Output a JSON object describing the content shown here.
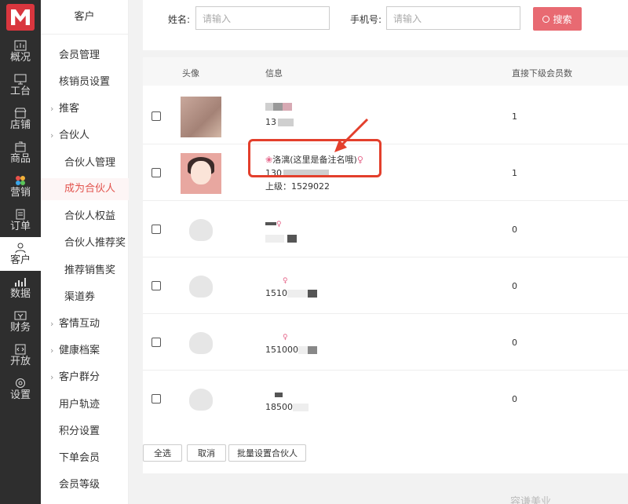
{
  "rail": {
    "items": [
      {
        "label": "概况",
        "icon": "chart-icon"
      },
      {
        "label": "工台",
        "icon": "monitor-icon"
      },
      {
        "label": "店铺",
        "icon": "store-icon"
      },
      {
        "label": "商品",
        "icon": "box-icon"
      },
      {
        "label": "营销",
        "icon": "marketing-icon"
      },
      {
        "label": "订单",
        "icon": "order-icon"
      },
      {
        "label": "客户",
        "icon": "user-icon"
      },
      {
        "label": "数据",
        "icon": "data-icon"
      },
      {
        "label": "财务",
        "icon": "finance-icon"
      },
      {
        "label": "开放",
        "icon": "code-icon"
      },
      {
        "label": "设置",
        "icon": "settings-icon"
      }
    ],
    "active": "客户"
  },
  "submenu": {
    "title": "客户",
    "items": [
      {
        "label": "会员管理"
      },
      {
        "label": "核销员设置"
      },
      {
        "label": "推客"
      },
      {
        "label": "合伙人"
      },
      {
        "label": "合伙人管理"
      },
      {
        "label": "成为合伙人"
      },
      {
        "label": "合伙人权益"
      },
      {
        "label": "合伙人推荐奖"
      },
      {
        "label": "推荐销售奖"
      },
      {
        "label": "渠道券"
      },
      {
        "label": "客情互动"
      },
      {
        "label": "健康档案"
      },
      {
        "label": "客户群分"
      },
      {
        "label": "用户轨迹"
      },
      {
        "label": "积分设置"
      },
      {
        "label": "下单会员"
      },
      {
        "label": "会员等级"
      }
    ]
  },
  "filter": {
    "name_label": "姓名:",
    "name_placeholder": "请输入",
    "phone_label": "手机号:",
    "phone_placeholder": "请输入",
    "search_label": "搜索"
  },
  "table": {
    "headers": {
      "avatar": "头像",
      "info": "信息",
      "downline": "直接下级会员数"
    },
    "rows": [
      {
        "line1": "",
        "line2": "13",
        "line3": "",
        "count": "1",
        "avatar": "photo"
      },
      {
        "line1": "洛漓(这里是备注名哦)",
        "line2": "130",
        "line3": "上级：1529022",
        "count": "1",
        "avatar": "cartoon"
      },
      {
        "line1": "",
        "line2": "",
        "line3": "",
        "count": "0",
        "avatar": "placeholder"
      },
      {
        "line1": "",
        "line2": "1510",
        "line3": "",
        "count": "0",
        "avatar": "placeholder"
      },
      {
        "line1": "",
        "line2": "151000",
        "line3": "",
        "count": "0",
        "avatar": "placeholder"
      },
      {
        "line1": "",
        "line2": "18500",
        "line3": "",
        "count": "0",
        "avatar": "placeholder"
      }
    ]
  },
  "actions": {
    "select_all": "全选",
    "cancel": "取消",
    "batch_set": "批量设置合伙人"
  },
  "brand": "容谦美业"
}
